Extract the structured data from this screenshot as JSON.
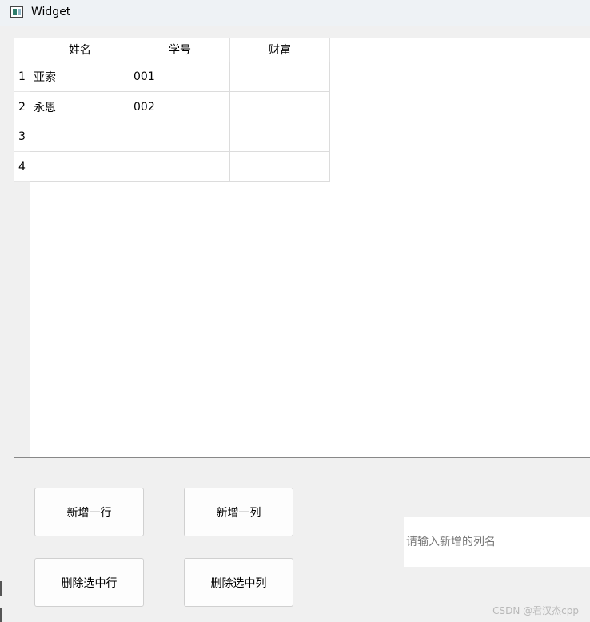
{
  "window": {
    "title": "Widget"
  },
  "table": {
    "headers": [
      "姓名",
      "学号",
      "财富"
    ],
    "row_labels": [
      "1",
      "2",
      "3",
      "4"
    ],
    "rows": [
      [
        "亚索",
        "001",
        ""
      ],
      [
        "永恩",
        "002",
        ""
      ],
      [
        "",
        "",
        ""
      ],
      [
        "",
        "",
        ""
      ]
    ]
  },
  "buttons": {
    "add_row": "新增一行",
    "add_col": "新增一列",
    "del_row": "删除选中行",
    "del_col": "删除选中列"
  },
  "column_name_input": {
    "value": "",
    "placeholder": "请输入新增的列名"
  },
  "watermark": "CSDN @君汉杰cpp"
}
